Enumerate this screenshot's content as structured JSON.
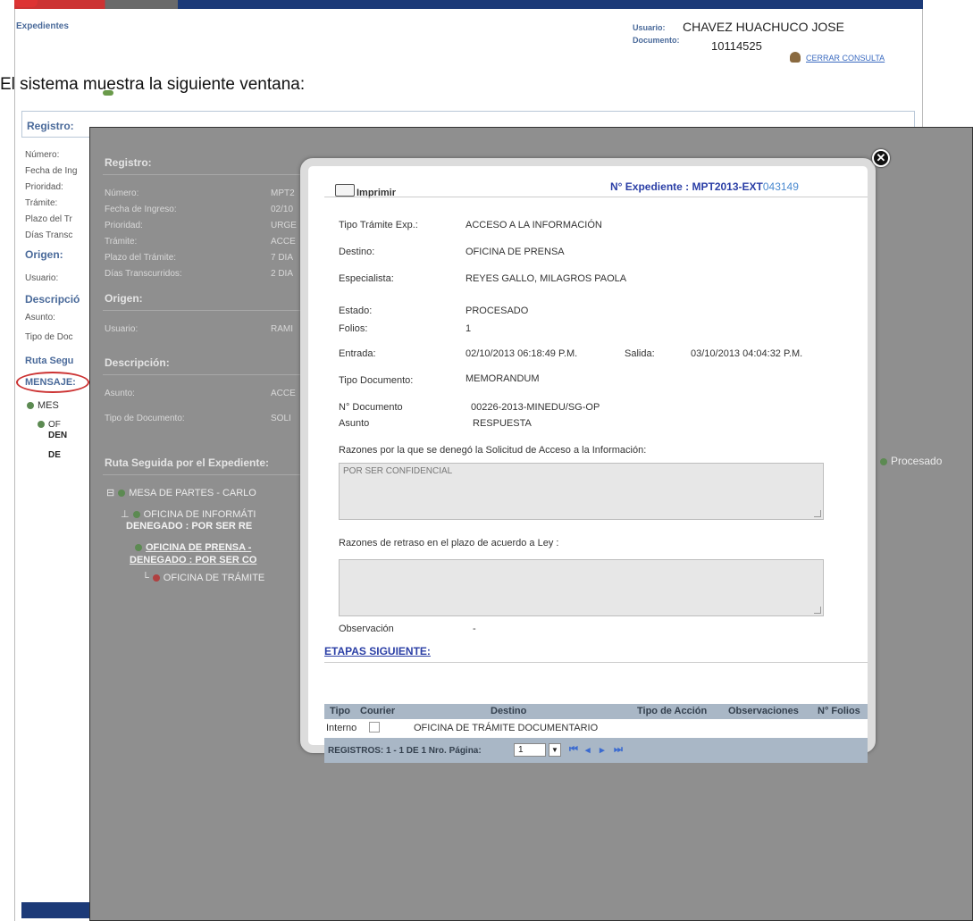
{
  "back": {
    "app_title": "Expedientes",
    "user_label": "Usuario:",
    "user_name": "CHAVEZ HUACHUCO JOSE",
    "doc_label": "Documento:",
    "doc_number": "10114525",
    "close_link": "CERRAR CONSULTA",
    "caption": "El sistema muestra la siguiente ventana:",
    "registro": "Registro:",
    "fields": [
      "Número:",
      "Fecha de Ing",
      "Prioridad:",
      "Trámite:",
      "Plazo del Tr",
      "Días Transc"
    ],
    "origen": "Origen:",
    "usuario": "Usuario:",
    "descripcion": "Descripció",
    "asunto": "Asunto:",
    "tipo_doc": "Tipo de Doc",
    "ruta": "Ruta Segu",
    "mensaje": "MENSAJE:",
    "tree": [
      "MES",
      "OF",
      "DEN",
      "DE"
    ]
  },
  "mid": {
    "registro": "Registro:",
    "fields": [
      {
        "label": "Número:",
        "value": "MPT2"
      },
      {
        "label": "Fecha de Ingreso:",
        "value": "02/10"
      },
      {
        "label": "Prioridad:",
        "value": "URGE"
      },
      {
        "label": "Trámite:",
        "value": "ACCE"
      },
      {
        "label": "Plazo del Trámite:",
        "value": "7 DIA"
      },
      {
        "label": "Días Transcurridos:",
        "value": "2 DIA"
      }
    ],
    "origen": "Origen:",
    "usuario_label": "Usuario:",
    "usuario_value": "RAMI",
    "descripcion": "Descripción:",
    "asunto_label": "Asunto:",
    "asunto_value": "ACCE",
    "tipo_doc_label": "Tipo de Documento:",
    "tipo_doc_value": "SOLI",
    "ruta": "Ruta Seguida por el Expediente:",
    "procesado": "Procesado",
    "tree": [
      "MESA DE PARTES - CARLO",
      "OFICINA DE INFORMÁTI",
      "DENEGADO : POR SER RE",
      "OFICINA DE PRENSA -",
      "DENEGADO : POR SER CO",
      "OFICINA DE TRÁMITE"
    ]
  },
  "modal": {
    "print_label": "Imprimir",
    "expediente_label": "N° Expediente :",
    "expediente_code": "MPT2013-EXT",
    "expediente_num": "043149",
    "tipo_tramite_label": "Tipo Trámite Exp.:",
    "tipo_tramite_value": "ACCESO A LA INFORMACIÓN",
    "destino_label": "Destino:",
    "destino_value": "OFICINA DE PRENSA",
    "especialista_label": "Especialista:",
    "especialista_value": "REYES GALLO, MILAGROS PAOLA",
    "estado_label": "Estado:",
    "estado_value": "PROCESADO",
    "folios_label": "Folios:",
    "folios_value": "1",
    "entrada_label": "Entrada:",
    "entrada_value": "02/10/2013 06:18:49 P.M.",
    "salida_label": "Salida:",
    "salida_value": "03/10/2013 04:04:32 P.M.",
    "tipo_doc_label": "Tipo Documento:",
    "tipo_doc_value": "MEMORANDUM",
    "n_doc_label": "N° Documento",
    "n_doc_value": "00226-2013-MINEDU/SG-OP",
    "asunto_label": "Asunto",
    "asunto_value": "RESPUESTA",
    "razones_label": "Razones por la que se denegó la Solicitud de Acceso a la Información:",
    "razones_value": "POR SER CONFIDENCIAL",
    "retraso_label": "Razones de retraso en el plazo de acuerdo a Ley :",
    "retraso_value": "",
    "observacion_label": "Observación",
    "observacion_value": "-",
    "etapas_title": "ETAPAS SIGUIENTE:",
    "table_headers": [
      "Tipo",
      "Courier",
      "Destino",
      "Tipo de Acción",
      "Observaciones",
      "N° Folios"
    ],
    "table_rows": [
      {
        "tipo": "Interno",
        "destino": "OFICINA DE TRÁMITE DOCUMENTARIO"
      }
    ],
    "pager_text": "REGISTROS: 1 - 1 DE 1 Nro. Página:",
    "pager_page": "1",
    "colors": {
      "link": "#2b3fa6",
      "table_header_bg": "#a9b7c6",
      "overlay": "#8f8f8f"
    }
  }
}
